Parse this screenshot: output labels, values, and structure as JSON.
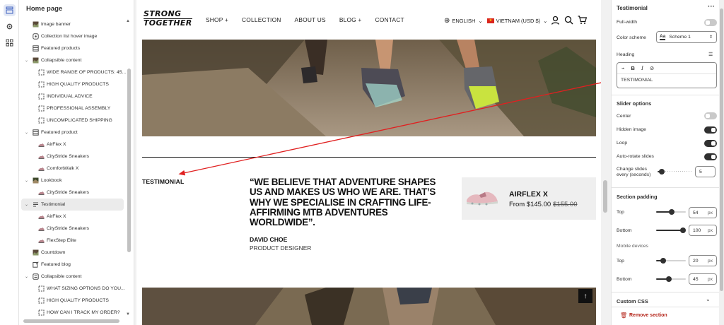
{
  "sidebar": {
    "title": "Home page",
    "items": [
      {
        "label": "Image banner",
        "level": 1,
        "icon": "image-icon"
      },
      {
        "label": "Collection list hover image",
        "level": 1,
        "icon": "collection-icon"
      },
      {
        "label": "Featured products",
        "level": 1,
        "icon": "products-icon"
      },
      {
        "label": "Collapsible content",
        "level": 1,
        "icon": "image-icon",
        "expanded": true
      },
      {
        "label": "WIDE RANGE OF PRODUCTS: 45...",
        "level": 2,
        "icon": "block-icon"
      },
      {
        "label": "HIGH QUALITY PRODUCTS",
        "level": 2,
        "icon": "block-icon"
      },
      {
        "label": "INDIVIDUAL ADVICE",
        "level": 2,
        "icon": "block-icon"
      },
      {
        "label": "PROFESSIONAL ASSEMBLY",
        "level": 2,
        "icon": "block-icon"
      },
      {
        "label": "UNCOMPLICATED SHIPPING",
        "level": 2,
        "icon": "block-icon"
      },
      {
        "label": "Featured product",
        "level": 1,
        "icon": "products-icon",
        "expanded": true
      },
      {
        "label": "AirFlex X",
        "level": 2,
        "icon": "shoe-icon"
      },
      {
        "label": "CityStride Sneakers",
        "level": 2,
        "icon": "shoe-icon"
      },
      {
        "label": "ComfortWalk X",
        "level": 2,
        "icon": "shoe-icon"
      },
      {
        "label": "Lookbook",
        "level": 1,
        "icon": "lookbook-icon",
        "expanded": true
      },
      {
        "label": "CityStride Sneakers",
        "level": 2,
        "icon": "shoe-icon"
      },
      {
        "label": "Testimonial",
        "level": 1,
        "icon": "testimonial-icon",
        "expanded": true,
        "selected": true
      },
      {
        "label": "AirFlex X",
        "level": 2,
        "icon": "shoe-icon"
      },
      {
        "label": "CityStride Sneakers",
        "level": 2,
        "icon": "shoe-icon"
      },
      {
        "label": "FlexStep Elite",
        "level": 2,
        "icon": "shoe-icon"
      },
      {
        "label": "Countdown",
        "level": 1,
        "icon": "image-icon"
      },
      {
        "label": "Featured blog",
        "level": 1,
        "icon": "blog-icon"
      },
      {
        "label": "Collapsible content",
        "level": 1,
        "icon": "collapsible-icon",
        "expanded": true
      },
      {
        "label": "WHAT SIZING OPTIONS DO YOU...",
        "level": 2,
        "icon": "block-icon"
      },
      {
        "label": "HIGH QUALITY PRODUCTS",
        "level": 2,
        "icon": "block-icon"
      },
      {
        "label": "HOW CAN I TRACK MY ORDER?",
        "level": 2,
        "icon": "block-icon"
      }
    ]
  },
  "store": {
    "logo_line1": "STRONG",
    "logo_line2": "TOGETHER",
    "nav": [
      "SHOP +",
      "COLLECTION",
      "ABOUT US",
      "BLOG +",
      "CONTACT"
    ],
    "language": "ENGLISH",
    "country": "VIETNAM (USD $)",
    "testimonial_heading": "TESTIMONIAL",
    "quote": "“WE BELIEVE THAT ADVENTURE SHAPES US AND MAKES US WHO WE ARE. THAT’S WHY WE SPECIALISE IN CRAFTING LIFE-AFFIRMING MTB ADVENTURES WORLDWIDE”.",
    "author": "DAVID CHOE",
    "role": "PRODUCT DESIGNER",
    "product_name": "AIRFLEX X",
    "product_price": "From $145.00",
    "product_compare": "$155.00"
  },
  "panel": {
    "title": "Testimonial",
    "full_width_label": "Full-width",
    "full_width": false,
    "color_scheme_label": "Color scheme",
    "color_scheme_value": "Scheme 1",
    "color_scheme_swatch": "Aa",
    "heading_label": "Heading",
    "heading_value": "TESTIMONIAL",
    "slider_title": "Slider options",
    "center_label": "Center",
    "center": false,
    "hidden_image_label": "Hidden image",
    "hidden_image": true,
    "loop_label": "Loop",
    "loop": true,
    "autorotate_label": "Auto-rotate slides",
    "autorotate": true,
    "change_slides_label1": "Change slides",
    "change_slides_label2": "every (seconds)",
    "change_slides_value": "5",
    "padding_title": "Section padding",
    "top_label": "Top",
    "top_value": "54",
    "bottom_label": "Bottom",
    "bottom_value": "100",
    "mobile_label": "Mobile devices",
    "m_top_label": "Top",
    "m_top_value": "20",
    "m_bottom_label": "Bottom",
    "m_bottom_value": "45",
    "unit": "px",
    "custom_css_label": "Custom CSS",
    "remove_label": "Remove section"
  },
  "colors": {
    "accent_arrow": "#e02020",
    "remove": "#b42318"
  }
}
